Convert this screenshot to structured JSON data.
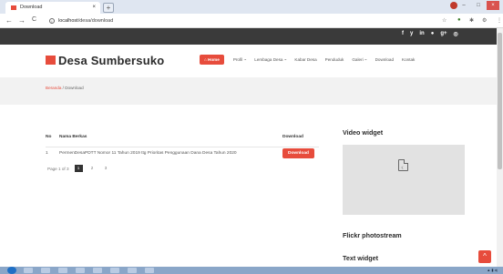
{
  "browser": {
    "tab_title": "Download",
    "tab_close": "×",
    "new_tab": "+",
    "back": "←",
    "forward": "→",
    "reload": "C",
    "url_host": "localhost",
    "url_path": "/desa/download",
    "win_min": "–",
    "win_max": "□",
    "win_close": "×"
  },
  "social": [
    "f",
    "y",
    "in",
    "●",
    "g+",
    "◎"
  ],
  "site": {
    "brand": "Desa Sumbersuko",
    "menu": {
      "home": "⌂ Home",
      "items": [
        "Profil ~",
        "Lembaga Desa ~",
        "Kabar Desa",
        "Penduduk",
        "Galeri ~",
        "Download",
        "Kontak"
      ]
    }
  },
  "breadcrumb": {
    "home": "Beranda",
    "sep": " / ",
    "current": "Download"
  },
  "table": {
    "headers": {
      "no": "No",
      "name": "Nama Berkas",
      "download": "Download"
    },
    "rows": [
      {
        "no": "1",
        "name": "PermenDesaPDTT Nomor 11 Tahun 2019 ttg Prioritas Penggunaan Dana Desa Tahun 2020",
        "button": "Download"
      }
    ]
  },
  "pager": {
    "label": "Page 1 of 3",
    "pages": [
      "1",
      "2",
      "3"
    ],
    "active_page": "1"
  },
  "sidebar": {
    "video_title": "Video widget",
    "video_placeholder": ":(",
    "flickr_title": "Flickr photostream",
    "text_title": "Text widget"
  },
  "back_to_top": "^",
  "colors": {
    "accent": "#e74c3c",
    "topbar": "#3a3a3a",
    "band": "#f2f2f2"
  }
}
